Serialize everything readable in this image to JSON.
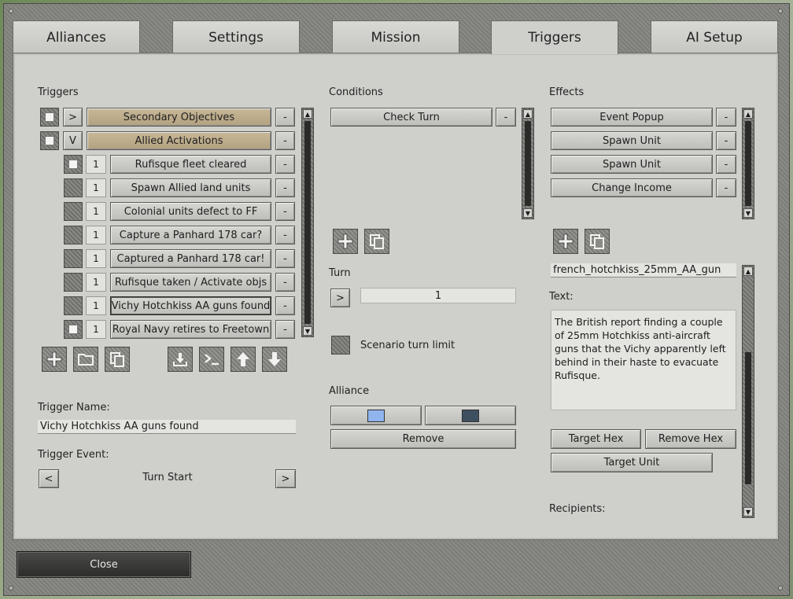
{
  "tabs": [
    {
      "label": "Alliances"
    },
    {
      "label": "Settings"
    },
    {
      "label": "Mission"
    },
    {
      "label": "Triggers"
    },
    {
      "label": "AI Setup"
    }
  ],
  "triggers": {
    "header": "Triggers",
    "groups": [
      {
        "toggle": ">",
        "label": "Secondary Objectives"
      },
      {
        "toggle": "V",
        "label": "Allied Activations"
      }
    ],
    "items": [
      {
        "num": "1",
        "label": "Rufisque fleet cleared",
        "checked": true
      },
      {
        "num": "1",
        "label": "Spawn Allied land units",
        "checked": false
      },
      {
        "num": "1",
        "label": "Colonial units defect to FF",
        "checked": false
      },
      {
        "num": "1",
        "label": "Capture a Panhard 178 car?",
        "checked": false
      },
      {
        "num": "1",
        "label": "Captured a Panhard 178 car!",
        "checked": false
      },
      {
        "num": "1",
        "label": "Rufisque taken / Activate objs",
        "checked": false
      },
      {
        "num": "1",
        "label": "Vichy Hotchkiss AA guns found",
        "checked": false
      },
      {
        "num": "1",
        "label": "Royal Navy retires to Freetown",
        "checked": true
      }
    ],
    "minus": "-",
    "name_label": "Trigger Name:",
    "name_value": "Vichy Hotchkiss AA guns found",
    "event_label": "Trigger Event:",
    "event_value": "Turn Start",
    "prev": "<",
    "next": ">"
  },
  "conditions": {
    "header": "Conditions",
    "items": [
      {
        "label": "Check Turn"
      }
    ],
    "turn_label": "Turn",
    "turn_toggle": ">",
    "turn_value": "1",
    "limit_label": "Scenario turn limit",
    "alliance_label": "Alliance",
    "alliance_colors": [
      "#8fb4ee",
      "#3e5060"
    ],
    "remove_label": "Remove"
  },
  "effects": {
    "header": "Effects",
    "items": [
      {
        "label": "Event Popup"
      },
      {
        "label": "Spawn Unit"
      },
      {
        "label": "Spawn Unit"
      },
      {
        "label": "Change Income"
      }
    ],
    "unit_value": "french_hotchkiss_25mm_AA_gun",
    "text_label": "Text:",
    "text_value": "The British report finding a couple of 25mm Hotchkiss anti-aircraft guns that the Vichy apparently left behind in their haste to evacuate Rufisque.",
    "target_hex": "Target Hex",
    "remove_hex": "Remove Hex",
    "target_unit": "Target Unit",
    "recipients_label": "Recipients:"
  },
  "close_label": "Close",
  "colors": {
    "panel": "#cfcfcb",
    "tan": "#c2b28f",
    "dark_button": "#3a3a38"
  }
}
